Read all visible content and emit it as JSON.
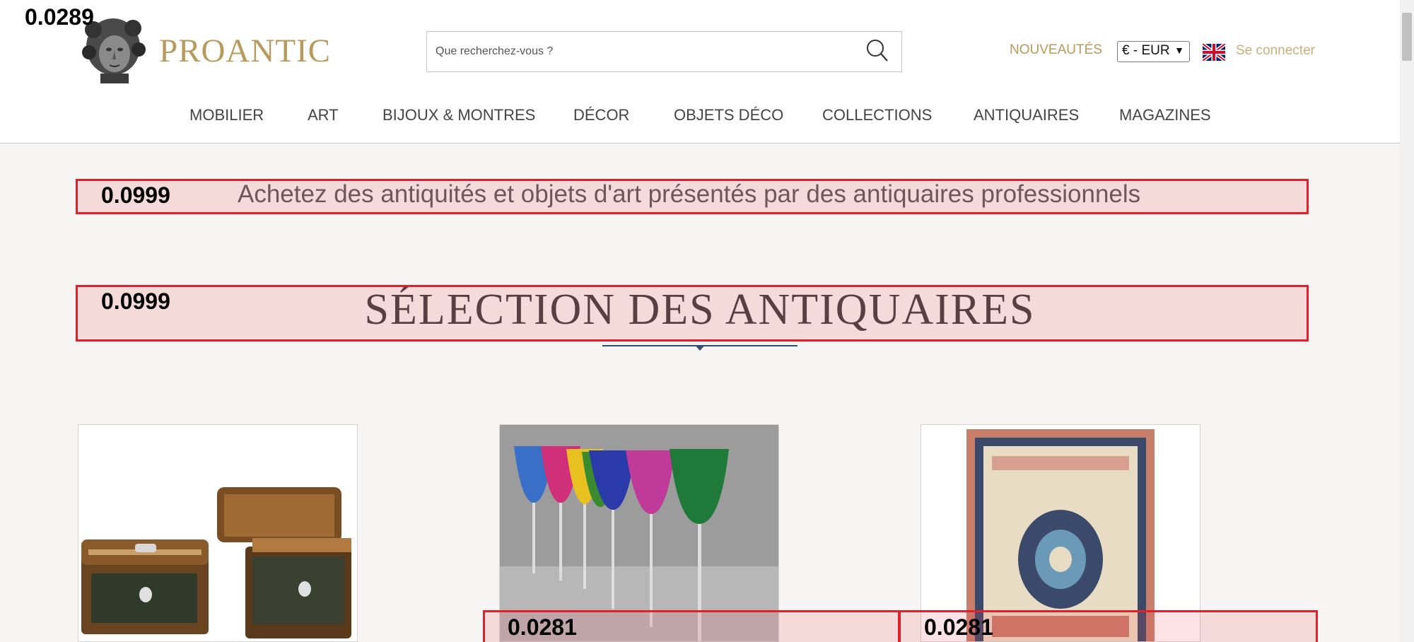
{
  "brand": {
    "name": "PROANTIC"
  },
  "search": {
    "placeholder": "Que recherchez-vous ?"
  },
  "header": {
    "new_label": "NOUVEAUTÉS",
    "currency": "€ - EUR",
    "login_label": "Se connecter"
  },
  "nav": {
    "items": [
      {
        "label": "MOBILIER"
      },
      {
        "label": "ART"
      },
      {
        "label": "BIJOUX & MONTRES"
      },
      {
        "label": "DÉCOR"
      },
      {
        "label": "OBJETS DÉCO"
      },
      {
        "label": "COLLECTIONS"
      },
      {
        "label": "ANTIQUAIRES"
      },
      {
        "label": "MAGAZINES"
      }
    ]
  },
  "tagline": "Achetez des antiquités et objets d'art présentés par des antiquaires professionnels",
  "section_title": "SÉLECTION DES ANTIQUAIRES",
  "overlay_scores": {
    "corner": "0.0289",
    "tagline": "0.0999",
    "title": "0.0999",
    "card2": "0.0281",
    "card3": "0.0281"
  },
  "colors": {
    "accent_gold": "#b79a5c",
    "overlay_red": "#e0202a",
    "rule_navy": "#2e4e6e"
  },
  "icons": [
    "search-icon",
    "uk-flag-icon",
    "chevron-down-icon"
  ]
}
